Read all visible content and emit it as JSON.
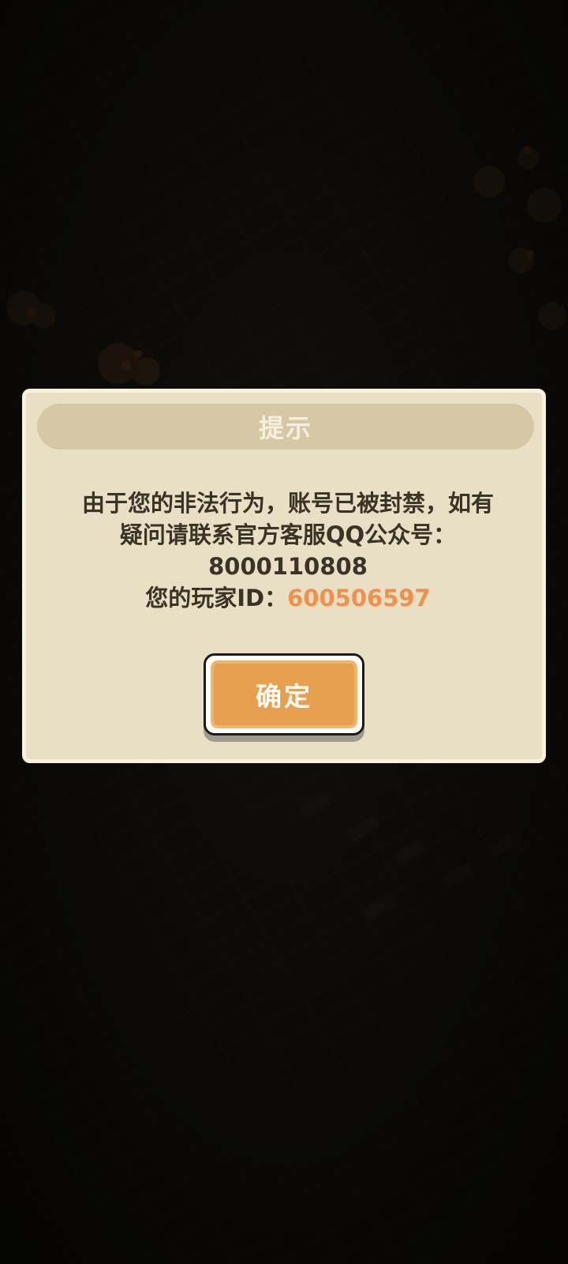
{
  "dialog": {
    "title": "提示",
    "message_line1": "由于您的非法行为，账号已被封禁，如有",
    "message_line2": "疑问请联系官方客服QQ公众号：",
    "qq_number": "8000110808",
    "player_id_label": "您的玩家ID：",
    "player_id": "600506597",
    "confirm_label": "确定"
  },
  "colors": {
    "dialog_bg": "#e8dfc4",
    "header_bg": "#d7c8a5",
    "message_text": "#3a3327",
    "player_id_accent": "#f0904a",
    "confirm_button": "#e6a04f"
  }
}
